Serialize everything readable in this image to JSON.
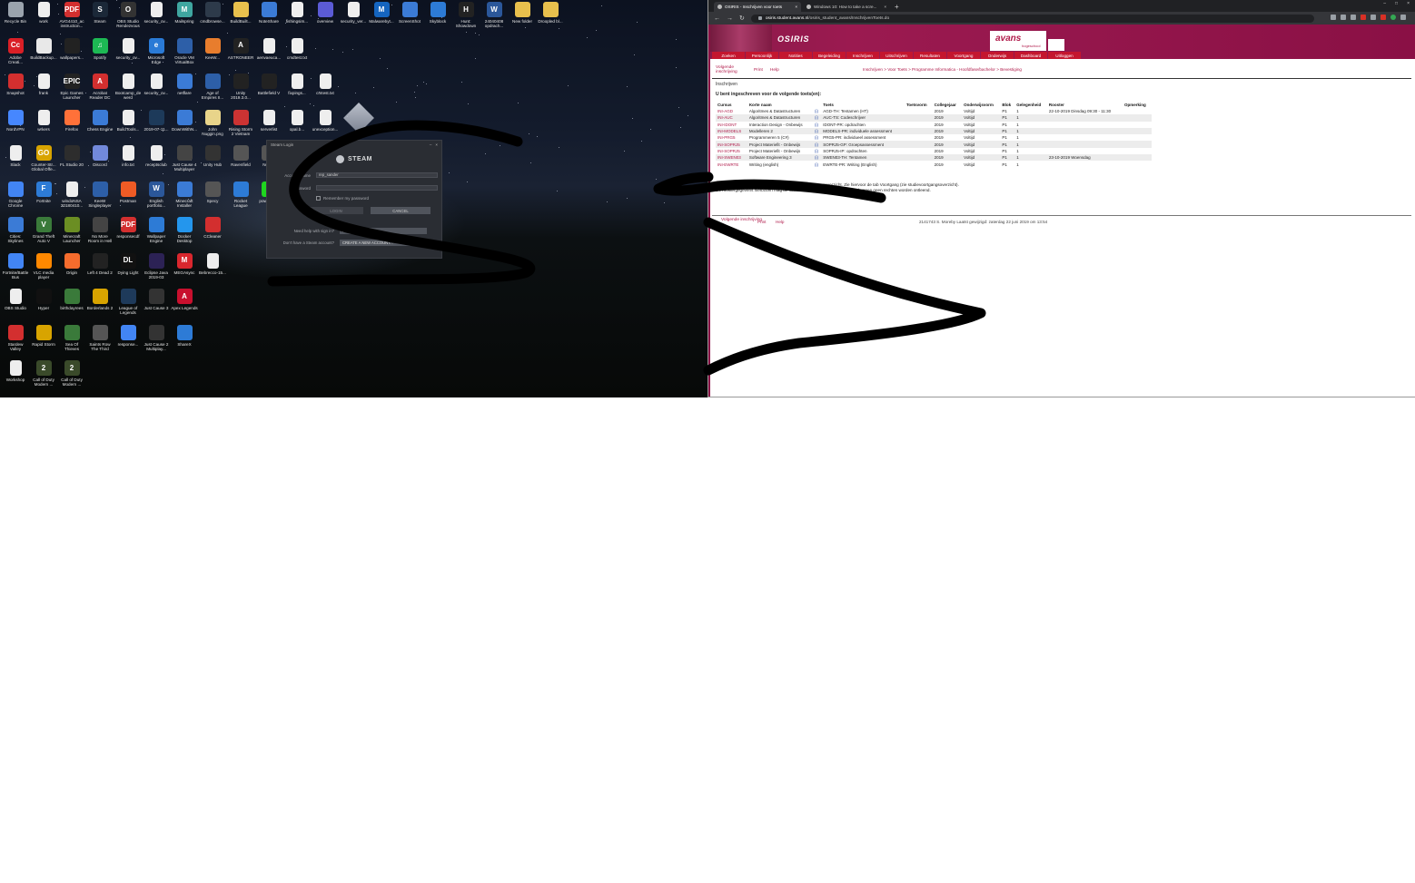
{
  "desktop": {
    "icons": [
      {
        "label": "Recycle Bin",
        "icon": "recycle-bin-icon",
        "color": "#9aa3ad",
        "glyph": ""
      },
      {
        "label": "work",
        "icon": "document-icon",
        "color": "#eeeeee",
        "glyph": ""
      },
      {
        "label": "AVG4410_ac instruction...",
        "icon": "pdf-icon",
        "color": "#d32f2f",
        "glyph": "PDF"
      },
      {
        "label": "Steam",
        "icon": "steam-icon",
        "color": "#1b2838",
        "glyph": "S"
      },
      {
        "label": "OBS Studio Rendezvous",
        "icon": "obs-icon",
        "color": "#333333",
        "glyph": "O"
      },
      {
        "label": "security_ov...",
        "icon": "document-icon",
        "color": "#eeeeee",
        "glyph": ""
      },
      {
        "label": "Mailspring",
        "icon": "mailspring-icon",
        "color": "#3fa6a0",
        "glyph": "M"
      },
      {
        "label": "cmdbrowse...",
        "icon": "cmd-icon",
        "color": "#2d3a4a",
        "glyph": ""
      },
      {
        "label": "BuildBuilt...",
        "icon": "folder-icon",
        "color": "#e8c04d",
        "glyph": ""
      },
      {
        "label": "NoteShare",
        "icon": "app-icon",
        "color": "#3b7bd6",
        "glyph": ""
      },
      {
        "label": "fishingsim...",
        "icon": "document-icon",
        "color": "#eeeeee",
        "glyph": ""
      },
      {
        "label": "overview",
        "icon": "app-icon",
        "color": "#5b5bd6",
        "glyph": ""
      },
      {
        "label": "security_ver...",
        "icon": "document-icon",
        "color": "#eeeeee",
        "glyph": ""
      },
      {
        "label": "Malwarebyt...",
        "icon": "malwarebytes-icon",
        "color": "#1565c0",
        "glyph": "M"
      },
      {
        "label": "ScreenShot",
        "icon": "app-icon",
        "color": "#3b7bd6",
        "glyph": ""
      },
      {
        "label": "Skyblock",
        "icon": "app-icon",
        "color": "#2d7bd6",
        "glyph": ""
      },
      {
        "label": "Hunt: Showdown",
        "icon": "hunt-icon",
        "color": "#222222",
        "glyph": "H"
      },
      {
        "label": "24040408 opdrach...",
        "icon": "word-icon",
        "color": "#2b579a",
        "glyph": "W"
      },
      {
        "label": "New folder",
        "icon": "folder-icon",
        "color": "#e8c04d",
        "glyph": ""
      },
      {
        "label": "Droopled bl...",
        "icon": "folder-icon",
        "color": "#e8c04d",
        "glyph": ""
      },
      {
        "label": "Adobe Creati...",
        "icon": "adobe-cc-icon",
        "color": "#da1f26",
        "glyph": "Cc"
      },
      {
        "label": "BuildBackup...",
        "icon": "java-icon",
        "color": "#e8e8e8",
        "glyph": ""
      },
      {
        "label": "wallpapers...",
        "icon": "image-icon",
        "color": "#222222",
        "glyph": ""
      },
      {
        "label": "Spotify",
        "icon": "spotify-icon",
        "color": "#1db954",
        "glyph": "♫"
      },
      {
        "label": "security_ov...",
        "icon": "document-icon",
        "color": "#eeeeee",
        "glyph": ""
      },
      {
        "label": "Microsoft Edge",
        "icon": "edge-icon",
        "color": "#2a7ad6",
        "glyph": "e"
      },
      {
        "label": "Oracle VM VirtualBox",
        "icon": "virtualbox-icon",
        "color": "#2d5fa8",
        "glyph": ""
      },
      {
        "label": "KeeW...",
        "icon": "app-icon",
        "color": "#e87d2d",
        "glyph": ""
      },
      {
        "label": "ASTRONEER",
        "icon": "astroneer-icon",
        "color": "#222222",
        "glyph": "A"
      },
      {
        "label": "aenvaeuca...",
        "icon": "document-icon",
        "color": "#eeeeee",
        "glyph": ""
      },
      {
        "label": "cmdtest.txt",
        "icon": "document-icon",
        "color": "#eeeeee",
        "glyph": ""
      },
      {
        "label": "Snapshot",
        "icon": "app-icon",
        "color": "#d32f2f",
        "glyph": ""
      },
      {
        "label": "frank",
        "icon": "document-icon",
        "color": "#eeeeee",
        "glyph": ""
      },
      {
        "label": "Epic Games Launcher",
        "icon": "epic-icon",
        "color": "#222222",
        "glyph": "EPIC"
      },
      {
        "label": "Acrobat Reader DC",
        "icon": "acrobat-icon",
        "color": "#d32f2f",
        "glyph": "A"
      },
      {
        "label": "Bootcamp_dewerd",
        "icon": "document-icon",
        "color": "#eeeeee",
        "glyph": ""
      },
      {
        "label": "security_ov...",
        "icon": "document-icon",
        "color": "#eeeeee",
        "glyph": ""
      },
      {
        "label": "netflare",
        "icon": "app-icon",
        "color": "#3b7bd6",
        "glyph": ""
      },
      {
        "label": "Age of Empires II...",
        "icon": "aoe-icon",
        "color": "#2d5fa8",
        "glyph": ""
      },
      {
        "label": "Unity 2019.3.0...",
        "icon": "unity-icon",
        "color": "#222222",
        "glyph": ""
      },
      {
        "label": "Battlefield V",
        "icon": "bf-icon",
        "color": "#222222",
        "glyph": ""
      },
      {
        "label": "fixpings...",
        "icon": "document-icon",
        "color": "#eeeeee",
        "glyph": ""
      },
      {
        "label": "cmtest.txt",
        "icon": "document-icon",
        "color": "#eeeeee",
        "glyph": ""
      },
      {
        "label": "NordVPN",
        "icon": "nordvpn-icon",
        "color": "#4687ff",
        "glyph": ""
      },
      {
        "label": "wrkers",
        "icon": "document-icon",
        "color": "#eeeeee",
        "glyph": ""
      },
      {
        "label": "Firefox",
        "icon": "firefox-icon",
        "color": "#ff7139",
        "glyph": ""
      },
      {
        "label": "Chess Engine",
        "icon": "app-icon",
        "color": "#3b7bd6",
        "glyph": ""
      },
      {
        "label": "BuildTools...",
        "icon": "document-icon",
        "color": "#eeeeee",
        "glyph": ""
      },
      {
        "label": "2019-07-11...",
        "icon": "image-icon",
        "color": "#1d3a5a",
        "glyph": ""
      },
      {
        "label": "DownWithN...",
        "icon": "app-icon",
        "color": "#3b7bd6",
        "glyph": ""
      },
      {
        "label": "John Nuggin.png",
        "icon": "image-icon",
        "color": "#e8d48a",
        "glyph": ""
      },
      {
        "label": "Rising Storm 2 Vietnam",
        "icon": "rs2-icon",
        "color": "#cc3333",
        "glyph": ""
      },
      {
        "label": "serverlist",
        "icon": "document-icon",
        "color": "#eeeeee",
        "glyph": ""
      },
      {
        "label": "opal.b...",
        "icon": "document-icon",
        "color": "#eeeeee",
        "glyph": ""
      },
      {
        "label": "unexception...",
        "icon": "document-icon",
        "color": "#eeeeee",
        "glyph": ""
      },
      {
        "label": "Slack",
        "icon": "slack-icon",
        "color": "#eeeeee",
        "glyph": ""
      },
      {
        "label": "Counter-Str... Global Offe...",
        "icon": "csgo-icon",
        "color": "#d8a400",
        "glyph": "GO"
      },
      {
        "label": "FL Studio 20",
        "icon": "flstudio-icon",
        "color": "#2d2d2d",
        "glyph": ""
      },
      {
        "label": "Discord",
        "icon": "discord-icon",
        "color": "#7289da",
        "glyph": ""
      },
      {
        "label": "info.txt",
        "icon": "document-icon",
        "color": "#eeeeee",
        "glyph": ""
      },
      {
        "label": "receptsclub",
        "icon": "document-icon",
        "color": "#eeeeee",
        "glyph": ""
      },
      {
        "label": "Just Cause 4 Multiplayer",
        "icon": "jc4-icon",
        "color": "#444444",
        "glyph": ""
      },
      {
        "label": "Unity Hub",
        "icon": "unity-icon",
        "color": "#333333",
        "glyph": ""
      },
      {
        "label": "Ravenfield",
        "icon": "app-icon",
        "color": "#555555",
        "glyph": ""
      },
      {
        "label": "Neta...",
        "icon": "app-icon",
        "color": "#555555",
        "glyph": ""
      },
      {
        "label": "Google Chrome",
        "icon": "chrome-icon",
        "color": "#4285f4",
        "glyph": ""
      },
      {
        "label": "Fortnite",
        "icon": "fortnite-icon",
        "color": "#2d7bd6",
        "glyph": "F"
      },
      {
        "label": "windoNSA 20180410...",
        "icon": "document-icon",
        "color": "#eeeeee",
        "glyph": ""
      },
      {
        "label": "KeeW Singleplayer",
        "icon": "app-icon",
        "color": "#2d5fa8",
        "glyph": ""
      },
      {
        "label": "Postman",
        "icon": "postman-icon",
        "color": "#ef5b25",
        "glyph": ""
      },
      {
        "label": "English portfolio...",
        "icon": "word-icon",
        "color": "#2b579a",
        "glyph": "W"
      },
      {
        "label": "Minecraft Installer",
        "icon": "app-icon",
        "color": "#3b7bd6",
        "glyph": ""
      },
      {
        "label": "Specy",
        "icon": "app-icon",
        "color": "#555555",
        "glyph": ""
      },
      {
        "label": "Rocket League",
        "icon": "rocket-league-icon",
        "color": "#2d7bd6",
        "glyph": ""
      },
      {
        "label": "powerca...",
        "icon": "app-icon",
        "color": "#1fd61f",
        "glyph": ""
      },
      {
        "label": "Cities: Skylines",
        "icon": "cities-icon",
        "color": "#3b7bd6",
        "glyph": ""
      },
      {
        "label": "Grand Theft Auto V",
        "icon": "gta-icon",
        "color": "#3a7a3a",
        "glyph": "V"
      },
      {
        "label": "Minecraft Launcher",
        "icon": "minecraft-icon",
        "color": "#6b8e23",
        "glyph": ""
      },
      {
        "label": "No More Room in Hell",
        "icon": "nmrih-icon",
        "color": "#444444",
        "glyph": ""
      },
      {
        "label": "responsecdf",
        "icon": "pdf-icon",
        "color": "#d32f2f",
        "glyph": "PDF"
      },
      {
        "label": "Wallpaper Engine",
        "icon": "wallpaper-engine-icon",
        "color": "#2d7bd6",
        "glyph": ""
      },
      {
        "label": "Docker Desktop",
        "icon": "docker-icon",
        "color": "#2496ed",
        "glyph": ""
      },
      {
        "label": "CCleaner",
        "icon": "ccleaner-icon",
        "color": "#d32f2f",
        "glyph": ""
      },
      {
        "label": "Fortnite/Battle Bus",
        "icon": "chrome-icon",
        "color": "#4285f4",
        "glyph": ""
      },
      {
        "label": "VLC media player",
        "icon": "vlc-icon",
        "color": "#ff8800",
        "glyph": ""
      },
      {
        "label": "Origin",
        "icon": "origin-icon",
        "color": "#f56c2d",
        "glyph": ""
      },
      {
        "label": "Left 4 Dead 2",
        "icon": "l4d2-icon",
        "color": "#222222",
        "glyph": ""
      },
      {
        "label": "Dying Light",
        "icon": "dying-light-icon",
        "color": "#111111",
        "glyph": "DL"
      },
      {
        "label": "Eclipse Java 2019-03",
        "icon": "eclipse-icon",
        "color": "#2c2255",
        "glyph": ""
      },
      {
        "label": "MEGAsync",
        "icon": "mega-icon",
        "color": "#d9272e",
        "glyph": "M"
      },
      {
        "label": "Bebrecco-15...",
        "icon": "document-icon",
        "color": "#eeeeee",
        "glyph": ""
      },
      {
        "label": "OBS Studio",
        "icon": "document-icon",
        "color": "#eeeeee",
        "glyph": ""
      },
      {
        "label": "Hyper",
        "icon": "hyper-icon",
        "color": "#111111",
        "glyph": ""
      },
      {
        "label": "birthdayrees",
        "icon": "app-icon",
        "color": "#3a7a3a",
        "glyph": ""
      },
      {
        "label": "Borderlands 2",
        "icon": "borderlands-icon",
        "color": "#d8a400",
        "glyph": ""
      },
      {
        "label": "League of Legends",
        "icon": "lol-icon",
        "color": "#1e3a5a",
        "glyph": ""
      },
      {
        "label": "Just Cause 3",
        "icon": "jc3-icon",
        "color": "#333333",
        "glyph": ""
      },
      {
        "label": "Apex Legends",
        "icon": "apex-icon",
        "color": "#c8102e",
        "glyph": "A"
      },
      {
        "label": "Stardew Valley",
        "icon": "stardew-icon",
        "color": "#d32f2f",
        "glyph": ""
      },
      {
        "label": "Rapid Storm",
        "icon": "app-icon",
        "color": "#d8a400",
        "glyph": ""
      },
      {
        "label": "Sea Of Thieves",
        "icon": "sot-icon",
        "color": "#3a7a3a",
        "glyph": ""
      },
      {
        "label": "Saints Row The Third",
        "icon": "saints-row-icon",
        "color": "#555555",
        "glyph": ""
      },
      {
        "label": "response...",
        "icon": "chrome-icon",
        "color": "#4285f4",
        "glyph": ""
      },
      {
        "label": "Just Cause 2 Multiplay...",
        "icon": "jc2-icon",
        "color": "#333333",
        "glyph": ""
      },
      {
        "label": "ShareX",
        "icon": "sharex-icon",
        "color": "#2d7bd6",
        "glyph": ""
      },
      {
        "label": "Workshop",
        "icon": "document-icon",
        "color": "#eeeeee",
        "glyph": ""
      },
      {
        "label": "Call of Duty Modern ...",
        "icon": "cod-icon",
        "color": "#3a4a2a",
        "glyph": "2"
      },
      {
        "label": "Call of Duty Modern ...",
        "icon": "cod-icon",
        "color": "#3a4a2a",
        "glyph": "2"
      }
    ],
    "steam_login": {
      "window_title": "Steam Login",
      "brand": "STEAM",
      "account_label": "Account name",
      "account_value": "rep_sander",
      "password_label": "Password",
      "password_value": "",
      "remember_label": "Remember my password",
      "login_button": "LOGIN",
      "cancel_button": "CANCEL",
      "help_label": "Need help with sign in?",
      "help_button": "I CAN'T SIGN IN...",
      "create_label": "Don't have a Steam account?",
      "create_button": "CREATE A NEW ACCOUNT..."
    }
  },
  "browser": {
    "tabs": [
      {
        "title": "OSIRIS - Inschrijven voor toets",
        "active": true
      },
      {
        "title": "Windows 10: How to take a scre...",
        "active": false
      }
    ],
    "url_host": "osiris.student.avans.nl",
    "url_path": "/osiris_student_avans/InschrijvenToets.do",
    "osiris": {
      "title": "OSIRIS",
      "brand": "avans",
      "brand_sub": "hogeschool",
      "main_nav": [
        "Zoeken",
        "Persoonlijk",
        "Notities",
        "Begeleiding",
        "Inschrijven",
        "Uitschrijven",
        "Resultaten",
        "Voortgang",
        "Onderwijs",
        "Dashboard",
        "Uitloggen"
      ],
      "sub_logo": "Volgende inschrijving",
      "sub_links": [
        "Print",
        "Help"
      ],
      "breadcrumb": "Inschrijven > Voor Toets > Programme Informatica - Hoofdfase/bachelor > Bevestiging",
      "page_heading": "Inschrijven",
      "intro": "U bent ingeschreven voor de volgende toets(en):",
      "columns": [
        "Cursus",
        "Korte naam",
        "",
        "Toets",
        "Toetsvorm",
        "Collegejaar",
        "Onderwijsvorm",
        "Blok",
        "Gelegenheid",
        "Rooster",
        "Opmerking"
      ],
      "rows": [
        [
          "INI-AGD",
          "Algoritmes & Datastructuren",
          "(i)",
          "AGD-TH: Tentamen (HT)",
          "",
          "2019",
          "Voltijd",
          "P1",
          "1",
          "22-10-2019  Dinsdag   09:30 - 11:30",
          ""
        ],
        [
          "INI-AUC",
          "Algoritmes & Datastructuren",
          "(i)",
          "AUC-TS: Codeschrijver",
          "",
          "2019",
          "Voltijd",
          "P1",
          "1",
          "",
          ""
        ],
        [
          "INI-IDONT",
          "Interaction Design - Onbewijs",
          "(i)",
          "IDONT-PR: opdrachten",
          "",
          "2019",
          "Voltijd",
          "P1",
          "1",
          "",
          ""
        ],
        [
          "INI-MODELS",
          "Modelleren 2",
          "(i)",
          "MODELS-PR: individuele assessment",
          "",
          "2019",
          "Voltijd",
          "P1",
          "1",
          "",
          ""
        ],
        [
          "INI-PRG5",
          "Programmeren 5 (C#)",
          "(i)",
          "PRG5-PR: individueel assessment",
          "",
          "2019",
          "Voltijd",
          "P1",
          "1",
          "",
          ""
        ],
        [
          "INI-SOPRJ5",
          "Project Materiefit - Onbewijs",
          "(i)",
          "SOPRJ5-GP: Groepsassessment",
          "",
          "2019",
          "Voltijd",
          "P1",
          "1",
          "",
          ""
        ],
        [
          "INI-SOPRJ5",
          "Project Materiefit - Onbewijs",
          "(i)",
          "SOPRJ5-IP: opdrachten",
          "",
          "2019",
          "Voltijd",
          "P1",
          "1",
          "",
          ""
        ],
        [
          "INI-SWEN03",
          "Software Engineering 3",
          "(i)",
          "SWEN03-TH: Tentamen",
          "",
          "2019",
          "Voltijd",
          "P1",
          "1",
          "23-10-2019  Woensdag",
          ""
        ],
        [
          "INI-EWRTE",
          "Writing (english)",
          "(i)",
          "EWRTE-PR: Writing (English)",
          "",
          "2019",
          "Voltijd",
          "P1",
          "1",
          "",
          ""
        ]
      ],
      "note_line1": "De toets-inschrijving is opgenomen in het studievoortgangsoverzicht. Zie hiervoor de tab Voortgang (zie studievoortgangsoverzicht).",
      "note_line2": "De roostergegevens hierboven mag de status voorlopig. Aan deze gegevens kunnen geen rechten worden ontleend.",
      "footer_logo": "Volgende inschrijving",
      "footer_links": [
        "Print",
        "Help"
      ],
      "footer_meta": "2141743   S. Moreby   Laatst gewijzigd: zaterdag 22 juni 2019 om 13:54"
    }
  }
}
